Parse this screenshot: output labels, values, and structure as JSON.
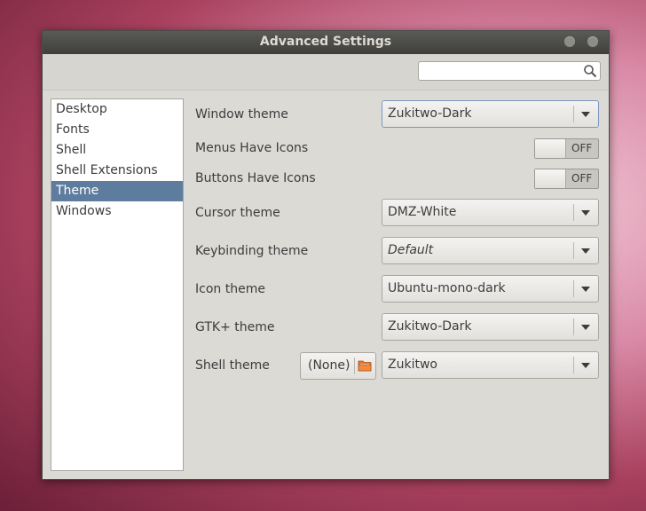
{
  "window": {
    "title": "Advanced Settings"
  },
  "search": {
    "value": "",
    "placeholder": "",
    "icon": "search-icon"
  },
  "sidebar": {
    "items": [
      {
        "label": "Desktop"
      },
      {
        "label": "Fonts"
      },
      {
        "label": "Shell"
      },
      {
        "label": "Shell Extensions"
      },
      {
        "label": "Theme",
        "selected": true
      },
      {
        "label": "Windows"
      }
    ],
    "selected_color": "#5e7d9e"
  },
  "settings": {
    "window_theme": {
      "label": "Window theme",
      "value": "Zukitwo-Dark"
    },
    "menus_have_icons": {
      "label": "Menus Have Icons",
      "state": "OFF"
    },
    "buttons_have_icons": {
      "label": "Buttons Have Icons",
      "state": "OFF"
    },
    "cursor_theme": {
      "label": "Cursor theme",
      "value": "DMZ-White"
    },
    "keybinding_theme": {
      "label": "Keybinding theme",
      "value": "Default"
    },
    "icon_theme": {
      "label": "Icon theme",
      "value": "Ubuntu-mono-dark"
    },
    "gtk_theme": {
      "label": "GTK+ theme",
      "value": "Zukitwo-Dark"
    },
    "shell_theme": {
      "label": "Shell theme",
      "file_label": "(None)",
      "value": "Zukitwo"
    }
  }
}
